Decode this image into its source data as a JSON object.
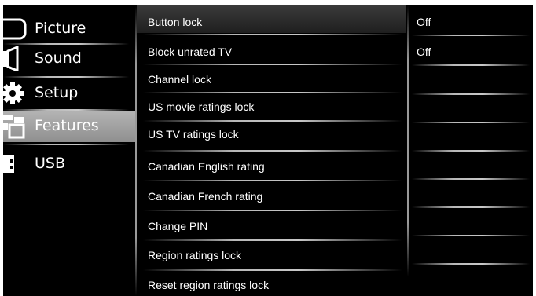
{
  "sidebar": {
    "items": [
      {
        "label": "Picture",
        "icon": "picture-icon"
      },
      {
        "label": "Sound",
        "icon": "speaker-icon"
      },
      {
        "label": "Setup",
        "icon": "gear-icon"
      },
      {
        "label": "Features",
        "icon": "features-icon",
        "selected": true
      },
      {
        "label": "USB",
        "icon": "usb-icon"
      }
    ]
  },
  "options": [
    {
      "label": "Button lock",
      "selected": true
    },
    {
      "label": "Block unrated TV"
    },
    {
      "label": "Channel lock"
    },
    {
      "label": "US movie ratings lock"
    },
    {
      "label": "US  TV ratings lock"
    },
    {
      "label": "Canadian English rating"
    },
    {
      "label": "Canadian French rating"
    },
    {
      "label": "Change PIN"
    },
    {
      "label": "Region ratings lock"
    },
    {
      "label": "Reset region ratings lock"
    }
  ],
  "values": [
    {
      "label": "Off"
    },
    {
      "label": "Off"
    }
  ],
  "colors": {
    "background": "#000000",
    "text": "#ffffff",
    "selected_sidebar": "#a0a0a0"
  }
}
